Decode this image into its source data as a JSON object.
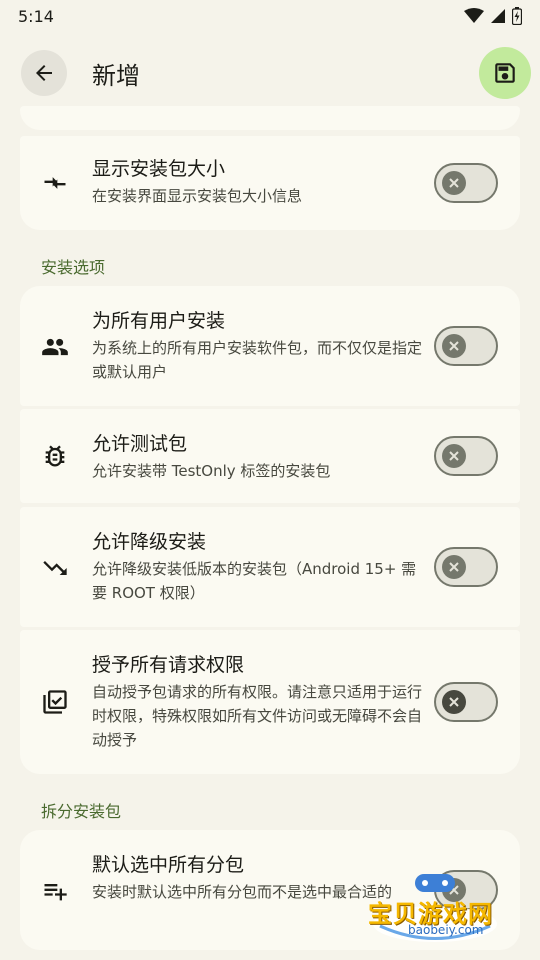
{
  "status_bar": {
    "time": "5:14"
  },
  "app_bar": {
    "title": "新增"
  },
  "sections": {
    "install_options": "安装选项",
    "split_packages": "拆分安装包"
  },
  "items": [
    {
      "title": "显示安装包大小",
      "desc": "在安装界面显示安装包大小信息",
      "icon": "compress-arrows-icon",
      "checked": false
    },
    {
      "title": "为所有用户安装",
      "desc": "为系统上的所有用户安装软件包，而不仅仅是指定或默认用户",
      "icon": "people-icon",
      "checked": false
    },
    {
      "title": "允许测试包",
      "desc": "允许安装带 TestOnly 标签的安装包",
      "icon": "bug-icon",
      "checked": false
    },
    {
      "title": "允许降级安装",
      "desc": "允许降级安装低版本的安装包（Android 15+ 需要 ROOT 权限）",
      "icon": "trending-down-icon",
      "checked": false
    },
    {
      "title": "授予所有请求权限",
      "desc": "自动授予包请求的所有权限。请注意只适用于运行时权限，特殊权限如所有文件访问或无障碍不会自动授予",
      "icon": "library-add-check-icon",
      "checked": false
    },
    {
      "title": "默认选中所有分包",
      "desc": "安装时默认选中所有分包而不是选中最合适的",
      "icon": "playlist-add-icon",
      "checked": false
    }
  ],
  "watermark": {
    "text": "宝贝游戏网",
    "url": "baobeiy.com"
  }
}
